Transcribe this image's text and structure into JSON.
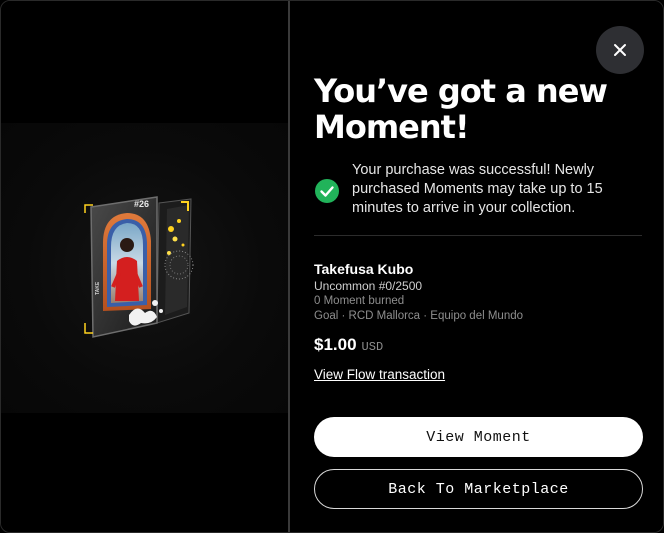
{
  "dialog": {
    "title": "You’ve got a new Moment!",
    "close_icon": "close-icon"
  },
  "success": {
    "icon": "check-circle-icon",
    "icon_color": "#21b35a",
    "message": "Your purchase was successful! Newly purchased Moments may take up to 15 minutes to arrive in your collection."
  },
  "moment": {
    "player_name": "Takefusa Kubo",
    "edition": "Uncommon #0/2500",
    "burned": "0 Moment burned",
    "meta": "Goal · RCD Mallorca · Equipo del Mundo",
    "price": "$1.00",
    "currency": "USD",
    "card_number": "#26",
    "card_side_text": "TAKE",
    "card_tier_color": "#d2692f"
  },
  "links": {
    "flow_transaction": "View Flow transaction"
  },
  "buttons": {
    "view_moment": "View Moment",
    "back_to_marketplace": "Back To Marketplace"
  }
}
